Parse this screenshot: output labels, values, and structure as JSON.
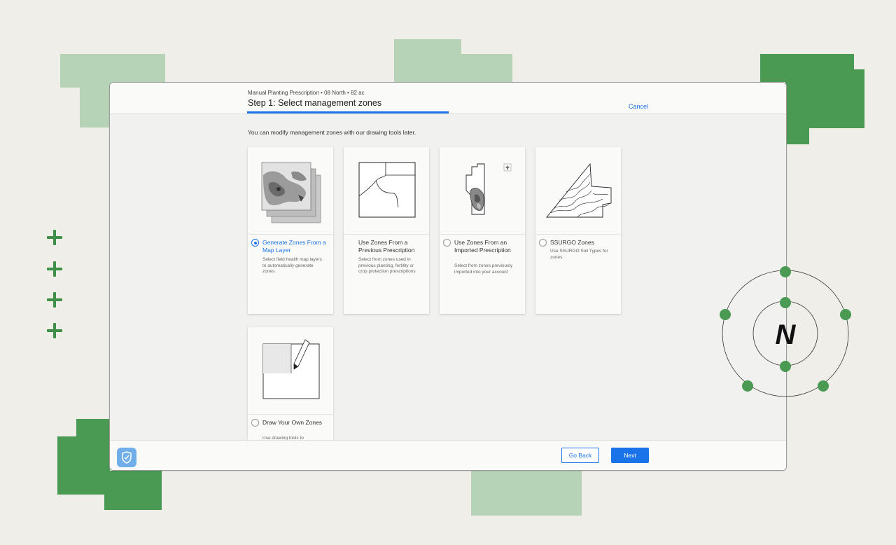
{
  "header": {
    "breadcrumb": "Manual Planting Prescription • 08 North • 82 ac",
    "title": "Step 1: Select management zones",
    "cancel_label": "Cancel"
  },
  "intro_text": "You can modify management zones with our drawing tools later.",
  "options": [
    {
      "title": "Generate Zones From a Map Layer",
      "desc": "Select field health map layers to automatically generate zones.",
      "selected": true
    },
    {
      "title": "Use Zones From a Previous Prescription",
      "desc": "Select from zones used in previous planting, fertility or crop protection prescriptions",
      "selected": false
    },
    {
      "title": "Use Zones From an Imported Prescription",
      "desc": "Select from zones previously imported into your account",
      "selected": false
    },
    {
      "title": "SSURGO Zones",
      "desc": "Use SSURGO Soil Types for zones",
      "selected": false
    },
    {
      "title": "Draw Your Own Zones",
      "desc": "Use drawing tools to",
      "selected": false
    }
  ],
  "footer": {
    "back_label": "Go Back",
    "next_label": "Next"
  },
  "compass_letter": "N",
  "colors": {
    "accent": "#1a73e8",
    "light_green": "#b7d3b7",
    "dark_green": "#4a9a54",
    "background": "#efeee9"
  },
  "icons": [
    "plus-icon",
    "shield-icon",
    "compass-icon"
  ]
}
